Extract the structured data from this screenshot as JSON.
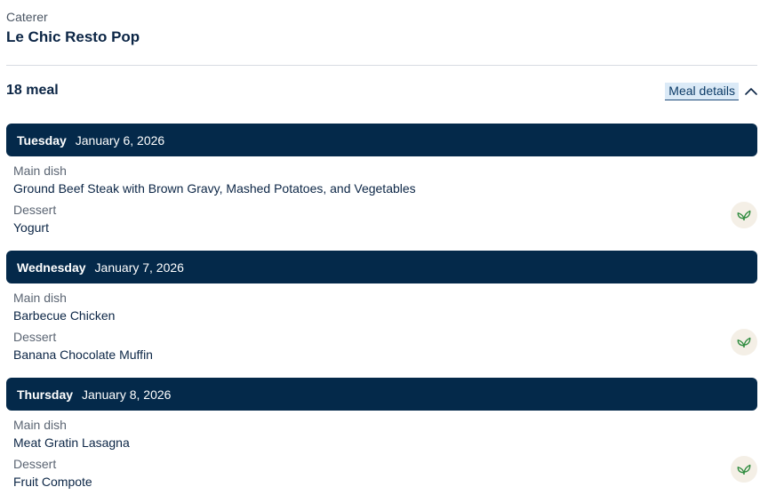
{
  "caterer": {
    "label": "Caterer",
    "name": "Le Chic Resto Pop"
  },
  "summary": {
    "meal_count": "18 meal",
    "details_label": "Meal details"
  },
  "days": [
    {
      "day": "Tuesday",
      "date": "January 6, 2026",
      "main_label": "Main dish",
      "main": "Ground Beef Steak with Brown Gravy, Mashed Potatoes, and Vegetables",
      "dessert_label": "Dessert",
      "dessert": "Yogurt",
      "icon": "leaf-icon"
    },
    {
      "day": "Wednesday",
      "date": "January 7, 2026",
      "main_label": "Main dish",
      "main": "Barbecue Chicken",
      "dessert_label": "Dessert",
      "dessert": "Banana Chocolate Muffin",
      "icon": "leaf-icon"
    },
    {
      "day": "Thursday",
      "date": "January 8, 2026",
      "main_label": "Main dish",
      "main": "Meat Gratin Lasagna",
      "dessert_label": "Dessert",
      "dessert": "Fruit Compote",
      "icon": "leaf-icon"
    }
  ],
  "colors": {
    "header_bg": "#04294a",
    "text_primary": "#0b2545",
    "leaf_green": "#2e8b3e",
    "badge_bg": "#f4efe6"
  }
}
